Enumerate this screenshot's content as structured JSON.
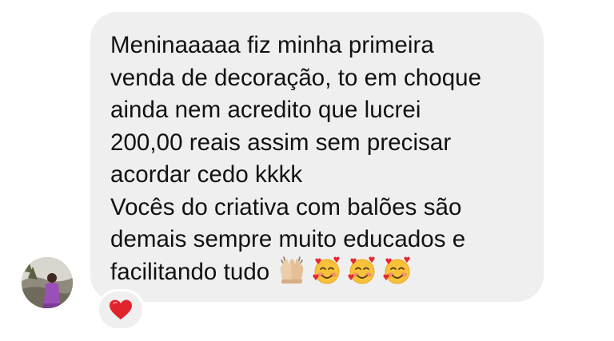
{
  "message": {
    "lines": [
      "Meninaaaaa fiz minha primeira",
      "venda de decoração, to em choque",
      "ainda nem acredito que lucrei",
      "200,00 reais assim sem precisar",
      "acordar cedo kkkk",
      "Vocês do criativa com balões são",
      "demais sempre muito educados e",
      "facilitando tudo"
    ],
    "emojis": [
      "raising-hands-icon",
      "smiling-face-with-hearts-icon",
      "smiling-face-with-hearts-icon",
      "smiling-face-with-hearts-icon"
    ]
  },
  "reaction": {
    "icon": "red-heart-icon",
    "color": "#e0242c"
  },
  "colors": {
    "bubble": "#efefef",
    "text": "#111111"
  }
}
